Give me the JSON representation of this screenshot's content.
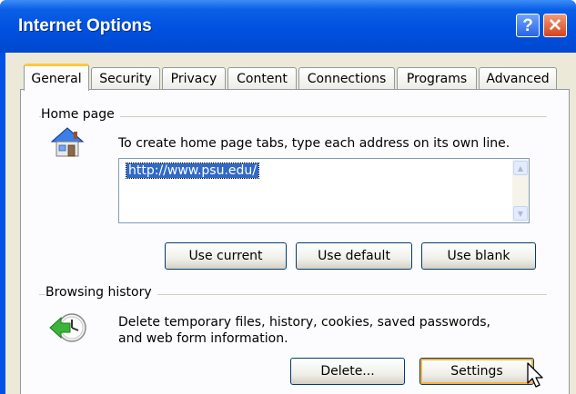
{
  "window": {
    "title": "Internet Options",
    "help_glyph": "?",
    "close_glyph": "✕"
  },
  "tabs": [
    {
      "label": "General",
      "active": true
    },
    {
      "label": "Security"
    },
    {
      "label": "Privacy"
    },
    {
      "label": "Content"
    },
    {
      "label": "Connections"
    },
    {
      "label": "Programs"
    },
    {
      "label": "Advanced"
    }
  ],
  "home_page": {
    "group_label": "Home page",
    "description": "To create home page tabs, type each address on its own line.",
    "url_value": "http://www.psu.edu/",
    "buttons": {
      "use_current": "Use current",
      "use_default": "Use default",
      "use_blank": "Use blank"
    }
  },
  "browsing_history": {
    "group_label": "Browsing history",
    "description_line1": "Delete temporary files, history, cookies, saved passwords,",
    "description_line2": "and web form information.",
    "buttons": {
      "delete": "Delete...",
      "settings": "Settings"
    }
  },
  "colors": {
    "titlebar": "#0054e3",
    "selection": "#316ac5",
    "focus_ring": "#f8b33e",
    "dialog_bg": "#ece9d8"
  }
}
